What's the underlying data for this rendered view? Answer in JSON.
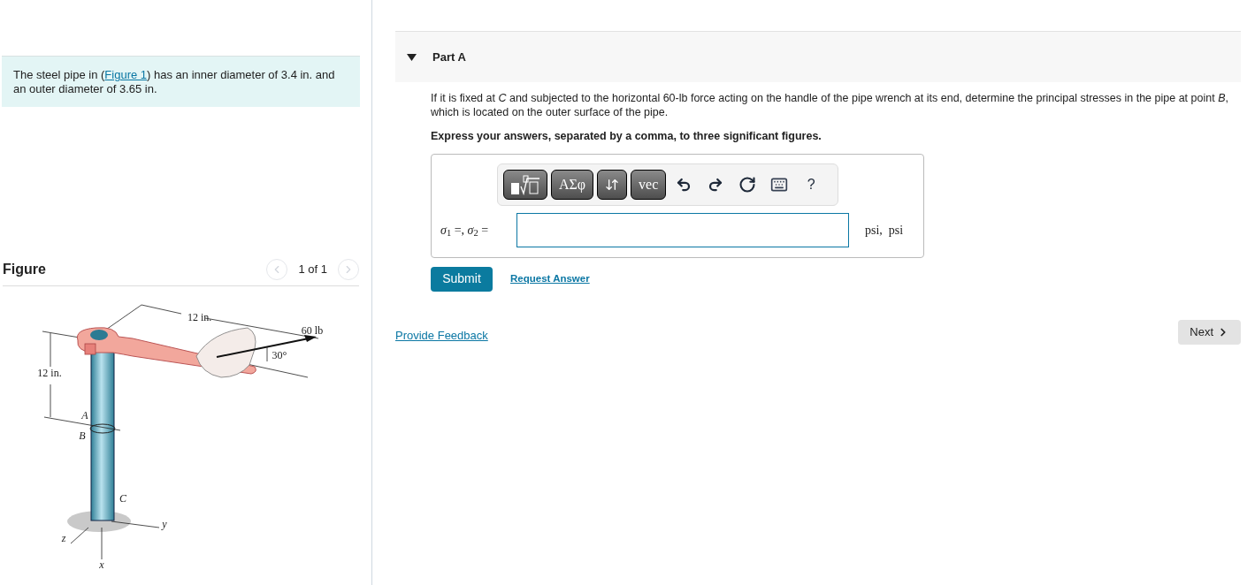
{
  "problem": {
    "before": "The steel pipe in (",
    "link": "Figure 1",
    "after": ") has an inner diameter of 3.4 in. and an outer diameter of 3.65 in."
  },
  "figure": {
    "title": "Figure",
    "pager": "1 of 1",
    "prev_disabled": true,
    "next_disabled": true,
    "labels": [
      {
        "kind": "dim",
        "text": "12 in."
      },
      {
        "kind": "force",
        "text": "60 lb"
      },
      {
        "kind": "angle",
        "text": "30°"
      },
      {
        "kind": "height",
        "text": "12 in."
      },
      {
        "kind": "pointA",
        "text": "A"
      },
      {
        "kind": "pointB",
        "text": "B"
      },
      {
        "kind": "pointC",
        "text": "C"
      },
      {
        "kind": "axisY",
        "text": "y"
      },
      {
        "kind": "axisZ",
        "text": "z"
      },
      {
        "kind": "axisX",
        "text": "x"
      }
    ]
  },
  "part": {
    "title": "Part A",
    "expanded": true,
    "question": "If it is fixed at *C* and subjected to the horizontal 60-lb force acting on the handle of the pipe wrench at its end, determine the principal stresses in the pipe at point *B*, which is located on the outer surface of the pipe.",
    "instruction": "Express your answers, separated by a comma, to three significant figures.",
    "toolbar": [
      {
        "kind": "template"
      },
      {
        "kind": "text",
        "text": "ΑΣφ"
      },
      {
        "kind": "updown"
      },
      {
        "kind": "text",
        "text": "vec"
      },
      {
        "kind": "undo"
      },
      {
        "kind": "redo"
      },
      {
        "kind": "reset"
      },
      {
        "kind": "keyboard"
      },
      {
        "kind": "help",
        "text": "?"
      }
    ],
    "answer_label": "*σ*$_{1}$ =,  *σ*$_{2}$ =",
    "units": "psi,  psi",
    "submit": "Submit",
    "request": "Request Answer"
  },
  "feedback": "Provide Feedback",
  "next": "Next"
}
